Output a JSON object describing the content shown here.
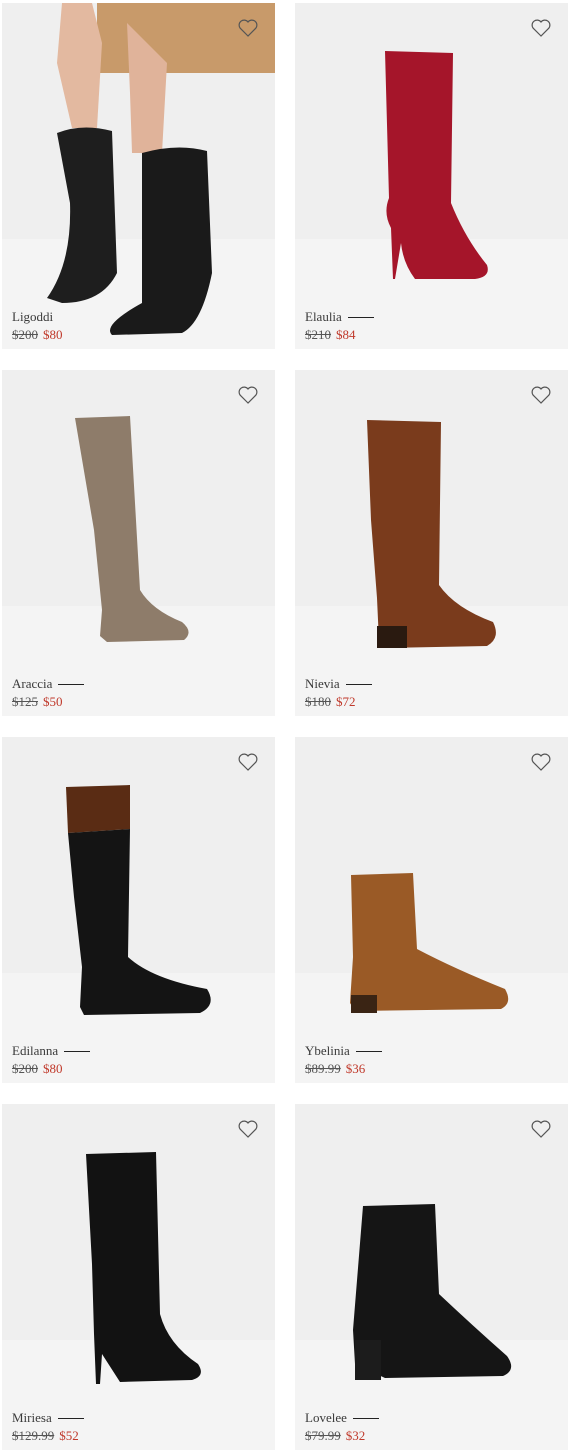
{
  "colors": {
    "sale": "#c0392b",
    "card_bg": "#efefef"
  },
  "products": [
    {
      "name": "Ligoddi",
      "old_price": "$200",
      "new_price": "$80",
      "icon": "heart-outline-icon"
    },
    {
      "name": "Elaulia",
      "old_price": "$210",
      "new_price": "$84",
      "icon": "heart-outline-icon"
    },
    {
      "name": "Araccia",
      "old_price": "$125",
      "new_price": "$50",
      "icon": "heart-outline-icon"
    },
    {
      "name": "Nievia",
      "old_price": "$180",
      "new_price": "$72",
      "icon": "heart-outline-icon"
    },
    {
      "name": "Edilanna",
      "old_price": "$200",
      "new_price": "$80",
      "icon": "heart-outline-icon"
    },
    {
      "name": "Ybelinia",
      "old_price": "$89.99",
      "new_price": "$36",
      "icon": "heart-outline-icon"
    },
    {
      "name": "Miriesa",
      "old_price": "$129.99",
      "new_price": "$52",
      "icon": "heart-outline-icon"
    },
    {
      "name": "Lovelee",
      "old_price": "$79.99",
      "new_price": "$32",
      "icon": "heart-outline-icon"
    }
  ]
}
